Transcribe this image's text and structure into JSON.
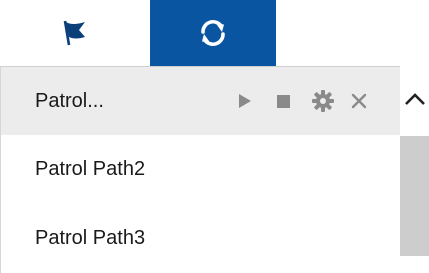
{
  "tabs": [
    {
      "icon": "flag-icon",
      "active": false
    },
    {
      "icon": "refresh-cycle-icon",
      "active": true
    }
  ],
  "colors": {
    "active_tab_bg": "#0a55a2",
    "icon_dark": "#0a3f7a",
    "selected_row_bg": "#ececec",
    "action_icon": "#8a8a8a",
    "scroll_thumb": "#cdcdcd"
  },
  "patrol_list": {
    "items": [
      {
        "label": "Patrol...",
        "selected": true
      },
      {
        "label": "Patrol Path2",
        "selected": false
      },
      {
        "label": "Patrol Path3",
        "selected": false
      }
    ],
    "actions": [
      "play-icon",
      "stop-icon",
      "settings-icon",
      "delete-icon"
    ]
  },
  "scrollbar": {
    "up_icon": "chevron-up-icon"
  }
}
